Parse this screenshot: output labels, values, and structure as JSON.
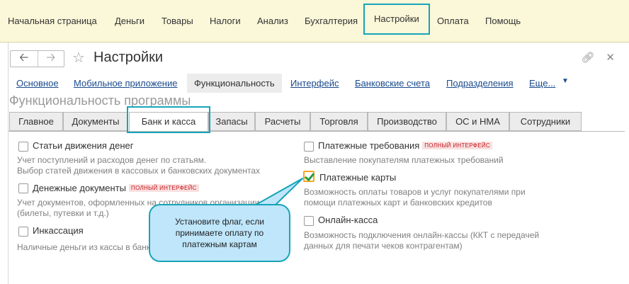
{
  "topbar": {
    "items": [
      {
        "label": "Начальная страница"
      },
      {
        "label": "Деньги"
      },
      {
        "label": "Товары"
      },
      {
        "label": "Налоги"
      },
      {
        "label": "Анализ"
      },
      {
        "label": "Бухгалтерия"
      },
      {
        "label": "Настройки"
      },
      {
        "label": "Оплата"
      },
      {
        "label": "Помощь"
      }
    ]
  },
  "window": {
    "title": "Настройки",
    "links": [
      {
        "label": "Основное"
      },
      {
        "label": "Мобильное приложение"
      },
      {
        "label": "Функциональность"
      },
      {
        "label": "Интерфейс"
      },
      {
        "label": "Банковские счета"
      },
      {
        "label": "Подразделения"
      },
      {
        "label": "Еще..."
      }
    ],
    "section_title": "Функциональность программы",
    "tabs": [
      {
        "label": "Главное"
      },
      {
        "label": "Документы"
      },
      {
        "label": "Банк и касса"
      },
      {
        "label": "Запасы"
      },
      {
        "label": "Расчеты"
      },
      {
        "label": "Торговля"
      },
      {
        "label": "Производство"
      },
      {
        "label": "ОС и НМА"
      },
      {
        "label": "Сотрудники"
      }
    ],
    "badge_text": "ПОЛНЫЙ ИНТЕРФЕЙС",
    "options_left": [
      {
        "label": "Статьи движения денег",
        "desc1": "Учет поступлений и расходов денег по статьям.",
        "desc2": "Выбор статей движения в кассовых и банковских документах"
      },
      {
        "label": "Денежные документы",
        "desc1": "Учет документов, оформленных на сотрудников организации",
        "desc2": "(билеты, путевки и т.д.)"
      },
      {
        "label": "Инкассация",
        "desc1": "Наличные деньги из кассы в банк"
      }
    ],
    "options_right": [
      {
        "label": "Платежные требования",
        "desc1": "Выставление покупателям платежных требований"
      },
      {
        "label": "Платежные карты",
        "desc1": "Возможность оплаты товаров и услуг покупателями при",
        "desc2": "помощи платежных карт и банковских кредитов"
      },
      {
        "label": "Онлайн-касса",
        "desc1": "Возможность подключения онлайн-кассы (ККТ с передачей",
        "desc2": "данных для печати чеков контрагентам)"
      }
    ]
  },
  "callout": {
    "line1": "Установите флаг, если",
    "line2": "принимаете оплату по",
    "line3": "платежным картам"
  },
  "colors": {
    "topbar_bg": "#fbf7d9",
    "highlight": "#17a4b9",
    "link": "#1a4b8e",
    "badge": "#c4161c",
    "callout_bg": "#bfe6fb",
    "checked_border": "#f5a623",
    "check_mark": "#2e9a3d"
  }
}
